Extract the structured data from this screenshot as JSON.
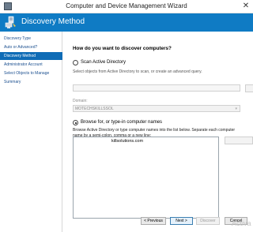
{
  "window": {
    "title": "Computer and Device Management Wizard",
    "close_glyph": "✕"
  },
  "header": {
    "title": "Discovery Method",
    "icon": "wizard-computer-icon",
    "color": "#0f7bc4"
  },
  "nav": {
    "items": [
      {
        "label": "Discovery Type",
        "active": false
      },
      {
        "label": "Auto or Advanced?",
        "active": false
      },
      {
        "label": "Discovery Method",
        "active": true
      },
      {
        "label": "Administrator Account",
        "active": false
      },
      {
        "label": "Select Objects to Manage",
        "active": false
      },
      {
        "label": "Summary",
        "active": false
      }
    ],
    "active_color": "#0f6cb6"
  },
  "main": {
    "question": "How do you want to discover computers?",
    "scan_ad": {
      "label": "Scan Active Directory",
      "selected": false,
      "help": "Select objects from Active Directory to scan, or create an advanced query."
    },
    "domain": {
      "label": "Domain:",
      "value": "MOTECHSKILLSSOL"
    },
    "browse": {
      "label": "Browse for, or type-in computer names",
      "selected": true,
      "help": "Browse Active Directory or type computer names into the list below. Separate each computer name by a semi-colon, comma or a new line:",
      "list_value": "killsolutions.com"
    }
  },
  "footer": {
    "previous": "< Previous",
    "next": "Next >",
    "discover": "Discover",
    "cancel": "Cancel"
  },
  "watermark": "Activa"
}
